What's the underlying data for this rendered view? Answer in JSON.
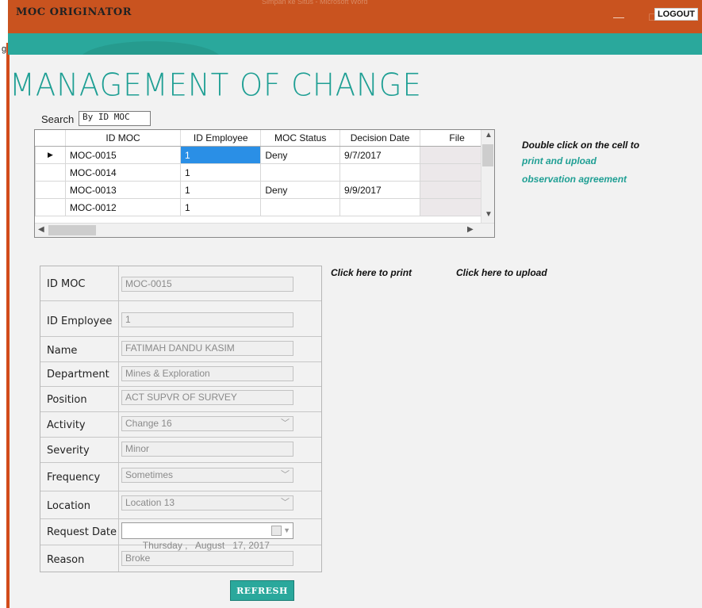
{
  "window": {
    "background_title": "Simpan ke Situs - Microsoft Word",
    "minimize": "—",
    "maximize": "□",
    "close": "✕"
  },
  "header": {
    "title": "MOC ORIGINATOR",
    "logout_label": "LOGOUT"
  },
  "page_title": "MANAGEMENT OF CHANGE",
  "search": {
    "label": "Search",
    "value": "By ID MOC"
  },
  "grid": {
    "columns": [
      "ID MOC",
      "ID Employee",
      "MOC Status",
      "Decision Date",
      "File"
    ],
    "rows": [
      {
        "id_moc": "MOC-0015",
        "id_employee": "1",
        "status": "Deny",
        "decision_date": "9/7/2017",
        "file": ""
      },
      {
        "id_moc": "MOC-0014",
        "id_employee": "1",
        "status": "",
        "decision_date": "",
        "file": ""
      },
      {
        "id_moc": "MOC-0013",
        "id_employee": "1",
        "status": "Deny",
        "decision_date": "9/9/2017",
        "file": ""
      },
      {
        "id_moc": "MOC-0012",
        "id_employee": "1",
        "status": "",
        "decision_date": "",
        "file": ""
      }
    ],
    "current_row_marker": "▶"
  },
  "hints": {
    "line1": "Double click on the cell to",
    "line2": "print and upload",
    "line3": "observation agreement",
    "print": "Click here to print",
    "upload": "Click here to upload"
  },
  "form": {
    "id_moc": {
      "label": "ID MOC",
      "value": "MOC-0015"
    },
    "id_employee": {
      "label": "ID Employee",
      "value": "1"
    },
    "name": {
      "label": "Name",
      "value": "FATIMAH DANDU KASIM"
    },
    "department": {
      "label": "Department",
      "value": "Mines & Exploration"
    },
    "position": {
      "label": "Position",
      "value": "ACT SUPVR OF SURVEY"
    },
    "activity": {
      "label": "Activity",
      "value": "Change 16"
    },
    "severity": {
      "label": "Severity",
      "value": "Minor"
    },
    "frequency": {
      "label": "Frequency",
      "value": "Sometimes"
    },
    "location": {
      "label": "Location",
      "value": "Location 13"
    },
    "request_date": {
      "label": "Request Date",
      "value": "Thursday ,   August   17, 2017"
    },
    "reason": {
      "label": "Reason",
      "value": "Broke"
    }
  },
  "refresh_label": "REFRESH",
  "colors": {
    "titlebar": "#c9531f",
    "accent": "#2aa89c",
    "selection": "#2a8fe6"
  }
}
